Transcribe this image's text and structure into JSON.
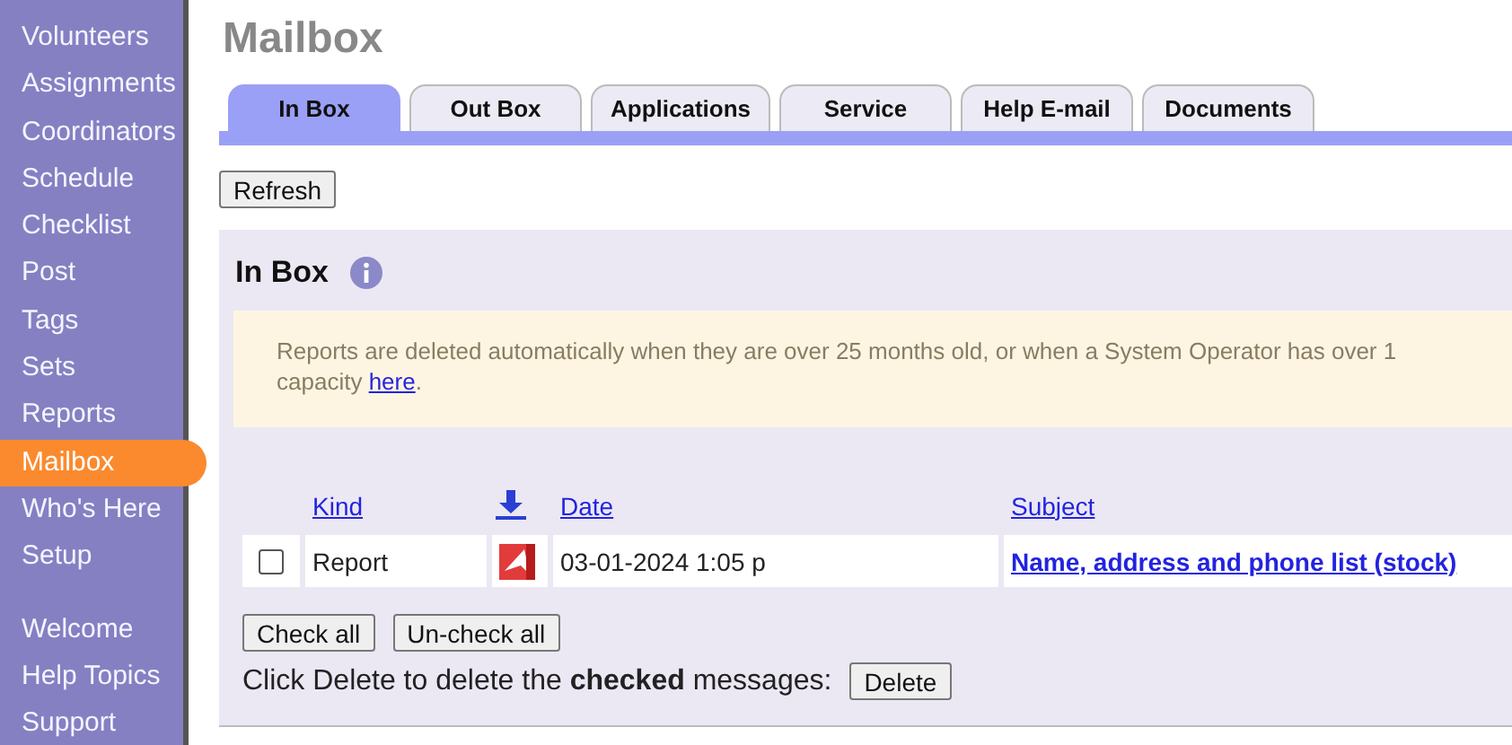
{
  "sidebar": {
    "groups": [
      [
        {
          "label": "Volunteers",
          "selected": false
        },
        {
          "label": "Assignments",
          "selected": false
        },
        {
          "label": "Coordinators",
          "selected": false
        },
        {
          "label": "Schedule",
          "selected": false
        },
        {
          "label": "Checklist",
          "selected": false
        },
        {
          "label": "Post",
          "selected": false
        },
        {
          "label": "Tags",
          "selected": false
        },
        {
          "label": "Sets",
          "selected": false
        },
        {
          "label": "Reports",
          "selected": false
        },
        {
          "label": "Mailbox",
          "selected": true
        },
        {
          "label": "Who's Here",
          "selected": false
        },
        {
          "label": "Setup",
          "selected": false
        }
      ],
      [
        {
          "label": "Welcome",
          "selected": false
        },
        {
          "label": "Help Topics",
          "selected": false
        },
        {
          "label": "Support",
          "selected": false
        }
      ]
    ]
  },
  "title": "Mailbox",
  "tabs": [
    {
      "label": "In Box",
      "selected": true
    },
    {
      "label": "Out Box",
      "selected": false
    },
    {
      "label": "Applications",
      "selected": false
    },
    {
      "label": "Service",
      "selected": false
    },
    {
      "label": "Help E-mail",
      "selected": false
    },
    {
      "label": "Documents",
      "selected": false
    }
  ],
  "refresh_button": "Refresh",
  "panel": {
    "heading": "In Box",
    "notice": {
      "text": "Reports are deleted automatically when they are over 25 months old, or when a System Operator has over 1\ncapacity ",
      "link": "here",
      "end": "."
    },
    "columns": [
      "Kind",
      "Date",
      "Subject"
    ],
    "rows": [
      {
        "checked": false,
        "kind": "Report",
        "date": "03-01-2024 1:05 p",
        "subject": "Name, address and phone list (stock)"
      }
    ],
    "check_all": "Check all",
    "uncheck_all": "Un-check all",
    "instruction": "Click Delete to delete the **checked** messages:",
    "delete_button": "Delete"
  }
}
